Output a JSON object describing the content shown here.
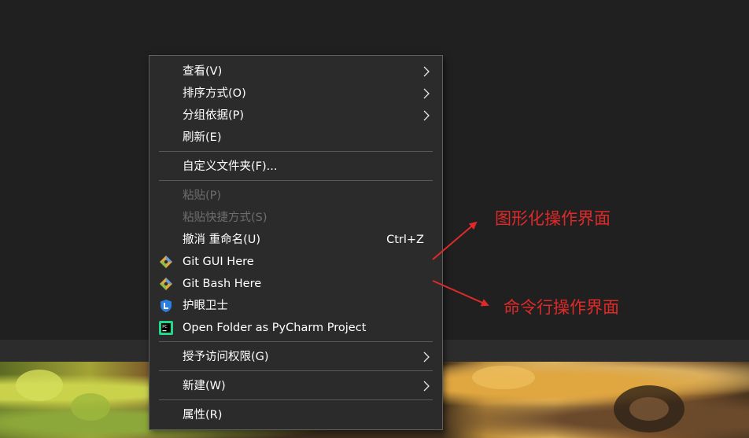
{
  "menu": {
    "items": [
      {
        "label": "查看(V)",
        "submenu": true
      },
      {
        "label": "排序方式(O)",
        "submenu": true
      },
      {
        "label": "分组依据(P)",
        "submenu": true
      },
      {
        "label": "刷新(E)"
      },
      {
        "label": "自定义文件夹(F)..."
      },
      {
        "label": "粘贴(P)",
        "disabled": true
      },
      {
        "label": "粘贴快捷方式(S)",
        "disabled": true
      },
      {
        "label": "撤消 重命名(U)",
        "shortcut": "Ctrl+Z"
      },
      {
        "label": "Git GUI Here",
        "icon": "git-gui-icon"
      },
      {
        "label": "Git Bash Here",
        "icon": "git-bash-icon"
      },
      {
        "label": "护眼卫士",
        "icon": "eye-guard-shield-icon"
      },
      {
        "label": "Open Folder as PyCharm Project",
        "icon": "pycharm-icon"
      },
      {
        "label": "授予访问权限(G)",
        "submenu": true
      },
      {
        "label": "新建(W)",
        "submenu": true
      },
      {
        "label": "属性(R)"
      }
    ]
  },
  "annotations": {
    "gui": "图形化操作界面",
    "cli": "命令行操作界面",
    "color": "#e02a2a"
  },
  "colors": {
    "menu_bg": "#2b2b2b",
    "menu_text": "#ffffff",
    "menu_disabled": "#6d6d6d",
    "desktop_bg": "#202020"
  }
}
